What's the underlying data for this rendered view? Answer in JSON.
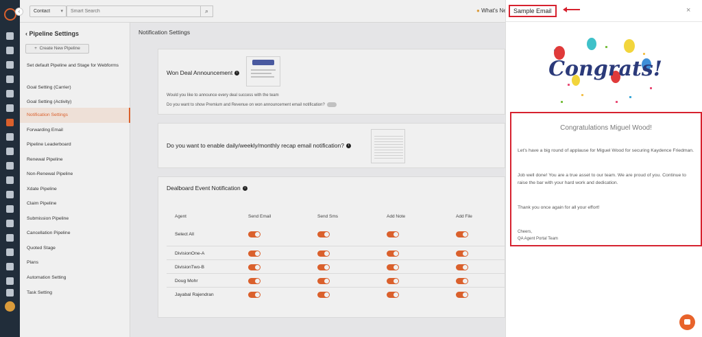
{
  "topbar": {
    "contact_select": "Contact",
    "search_placeholder": "Smart Search",
    "whats_new": "What's Ne"
  },
  "sidebar": {
    "title": "Pipeline Settings",
    "create_button": "Create New Pipeline",
    "items": [
      {
        "label": "Set default Pipeline and Stage for Webforms",
        "active": false
      },
      {
        "label": "Goal Setting (Carrier)",
        "active": false
      },
      {
        "label": "Goal Setting (Activity)",
        "active": false
      },
      {
        "label": "Notification Settings",
        "active": true
      },
      {
        "label": "Forwarding Email",
        "active": false
      },
      {
        "label": "Pipeline Leaderboard",
        "active": false
      },
      {
        "label": "Renewal Pipeline",
        "active": false
      },
      {
        "label": "Non-Renewal Pipeline",
        "active": false
      },
      {
        "label": "Xdate Pipeline",
        "active": false
      },
      {
        "label": "Claim Pipeline",
        "active": false
      },
      {
        "label": "Submission Pipeline",
        "active": false
      },
      {
        "label": "Cancellation Pipeline",
        "active": false
      },
      {
        "label": "Quoted Stage",
        "active": false
      },
      {
        "label": "Plans",
        "active": false
      },
      {
        "label": "Automation Setting",
        "active": false
      },
      {
        "label": "Task Setting",
        "active": false
      }
    ]
  },
  "main": {
    "title": "Notification Settings",
    "won_deal": {
      "title": "Won Deal Announcement",
      "q1": "Would you like to announce every deal success with the team",
      "q2": "Do you want to show Premium and Revenue on won announcement email notification?"
    },
    "recap": {
      "title": "Do you want to enable daily/weekly/monthly recap email notification?"
    },
    "dealboard": {
      "title": "Dealboard Event Notification",
      "columns": [
        "Agent",
        "Send Email",
        "Send Sms",
        "Add Note",
        "Add File"
      ],
      "rows": [
        "Select All",
        "DivisionOne-A",
        "DivisionTwo-B",
        "Doug Mohr",
        "Jayabal Rajendran"
      ]
    }
  },
  "panel": {
    "title": "Sample Email",
    "close": "×",
    "banner_text": "Congrats!",
    "email": {
      "heading": "Congratulations Miguel Wood!",
      "p1": "Let's have a big round of applause for Miguel Wood for securing Kaydence Friedman.",
      "p2": "Job well done! You are a true asset to our team. We are proud of you. Continue to raise the bar with your hard work and dedication.",
      "p3": "Thank you once again for all your effort!",
      "signoff": "Cheers,",
      "team": "QA Agent Portal Team"
    }
  },
  "colors": {
    "accent": "#e8632b",
    "highlight_red": "#d6212e",
    "rail": "#1f2c3a"
  }
}
